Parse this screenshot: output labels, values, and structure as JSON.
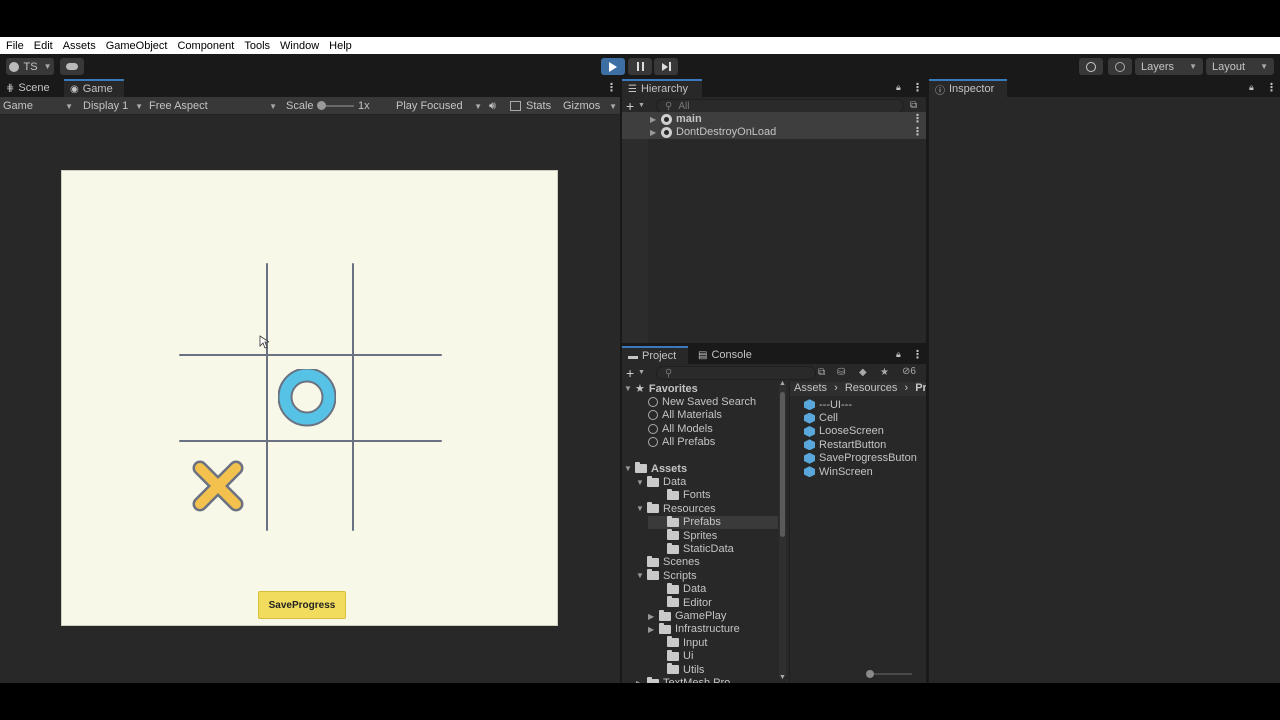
{
  "menu": [
    "File",
    "Edit",
    "Assets",
    "GameObject",
    "Component",
    "Tools",
    "Window",
    "Help"
  ],
  "toolbar": {
    "account": "TS",
    "layers": "Layers",
    "layout": "Layout"
  },
  "scene_tabs": {
    "scene": "Scene",
    "game": "Game"
  },
  "game_controls": {
    "view": "Game",
    "display": "Display 1",
    "aspect": "Free Aspect",
    "scale_label": "Scale",
    "scale_value": "1x",
    "play_mode": "Play Focused",
    "stats": "Stats",
    "gizmos": "Gizmos"
  },
  "game": {
    "save_button": "SaveProgress",
    "o_color": "#56c3e6",
    "x_color": "#f2c14e",
    "grid_color": "#6a7282",
    "background": "#f8f8e9"
  },
  "hierarchy": {
    "title": "Hierarchy",
    "search_placeholder": "All",
    "items": [
      "main",
      "DontDestroyOnLoad"
    ]
  },
  "inspector": {
    "title": "Inspector"
  },
  "project": {
    "tab_project": "Project",
    "tab_console": "Console",
    "hidden_count": "6",
    "favorites_label": "Favorites",
    "favorites": [
      "New Saved Search",
      "All Materials",
      "All Models",
      "All Prefabs"
    ],
    "assets_label": "Assets",
    "tree": [
      {
        "label": "Data",
        "depth": 1,
        "arrow": "open"
      },
      {
        "label": "Fonts",
        "depth": 2,
        "arrow": "none"
      },
      {
        "label": "Resources",
        "depth": 1,
        "arrow": "open"
      },
      {
        "label": "Prefabs",
        "depth": 2,
        "arrow": "none",
        "selected": true
      },
      {
        "label": "Sprites",
        "depth": 2,
        "arrow": "none"
      },
      {
        "label": "StaticData",
        "depth": 2,
        "arrow": "none"
      },
      {
        "label": "Scenes",
        "depth": 1,
        "arrow": "none"
      },
      {
        "label": "Scripts",
        "depth": 1,
        "arrow": "open"
      },
      {
        "label": "Data",
        "depth": 2,
        "arrow": "none"
      },
      {
        "label": "Editor",
        "depth": 2,
        "arrow": "none"
      },
      {
        "label": "GamePlay",
        "depth": 2,
        "arrow": "closed"
      },
      {
        "label": "Infrastructure",
        "depth": 2,
        "arrow": "closed"
      },
      {
        "label": "Input",
        "depth": 2,
        "arrow": "none"
      },
      {
        "label": "Ui",
        "depth": 2,
        "arrow": "none"
      },
      {
        "label": "Utils",
        "depth": 2,
        "arrow": "none"
      },
      {
        "label": "TextMesh Pro",
        "depth": 1,
        "arrow": "closed"
      }
    ],
    "breadcrumb": [
      "Assets",
      "Resources",
      "Pref"
    ],
    "files": [
      "---UI---",
      "Cell",
      "LooseScreen",
      "RestartButton",
      "SaveProgressButon",
      "WinScreen"
    ]
  }
}
